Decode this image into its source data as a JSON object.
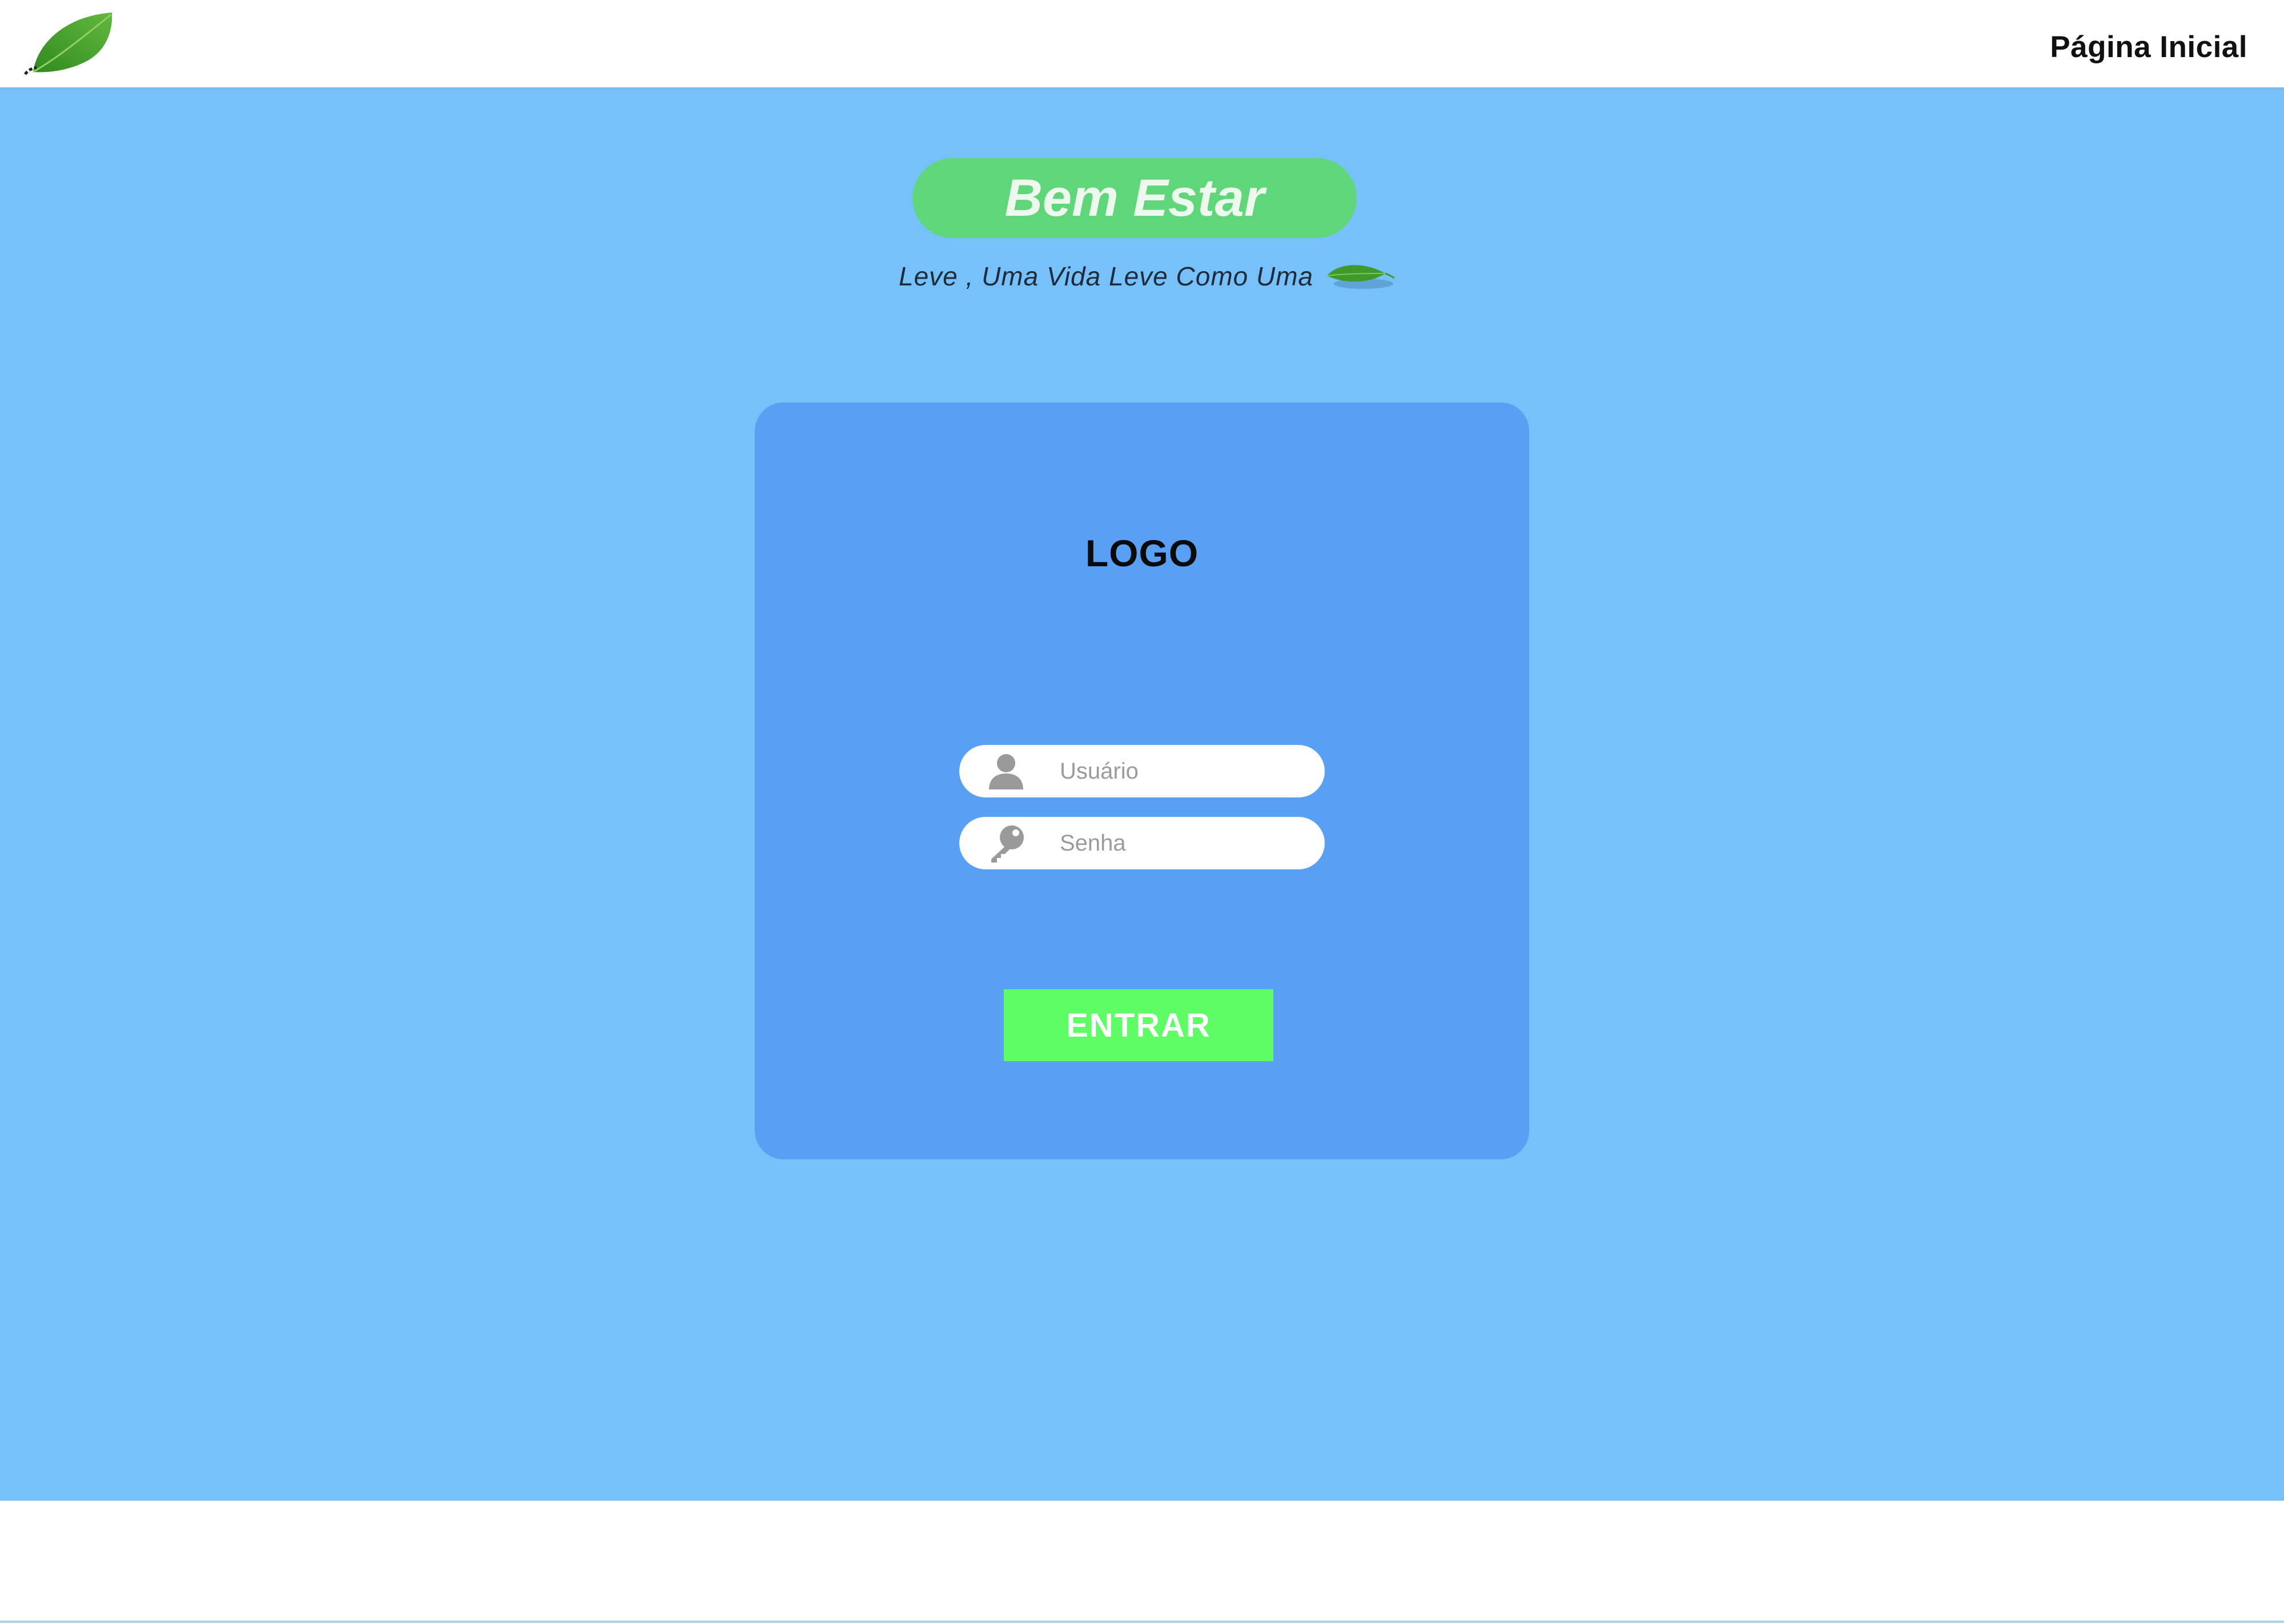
{
  "header": {
    "nav_home_label": "Página Inicial",
    "logo_icon": "leaf-icon"
  },
  "hero": {
    "title": "Bem Estar",
    "tagline": "Leve , Uma Vida Leve Como Uma",
    "tagline_icon": "leaf-icon"
  },
  "login": {
    "logo_text": "LOGO",
    "username": {
      "placeholder": "Usuário",
      "value": "",
      "icon": "user-icon"
    },
    "password": {
      "placeholder": "Senha",
      "value": "",
      "icon": "key-icon"
    },
    "submit_label": "ENTRAR"
  },
  "colors": {
    "background": "#76c1f9",
    "card": "#57a0f3",
    "title_pill": "#5ed679",
    "button": "#5efd65",
    "header": "#ffffff"
  }
}
